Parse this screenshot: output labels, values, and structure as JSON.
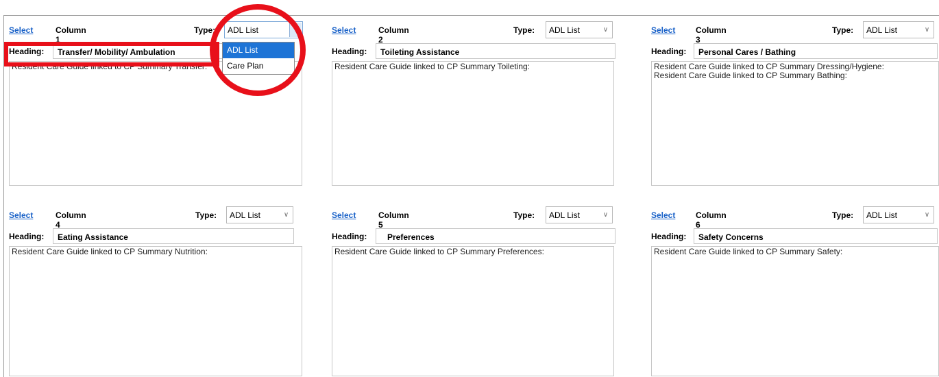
{
  "columns": [
    {
      "select": "Select",
      "name": "Column 1",
      "type_label": "Type:",
      "type_value": "ADL List",
      "heading_label": "Heading:",
      "heading_value": "Transfer/ Mobility/ Ambulation",
      "text": "Resident Care Guide linked to CP Summary Transfer:"
    },
    {
      "select": "Select",
      "name": "Column 2",
      "type_label": "Type:",
      "type_value": "ADL List",
      "heading_label": "Heading:",
      "heading_value": "Toileting Assistance",
      "text": "Resident Care Guide linked to CP Summary Toileting:"
    },
    {
      "select": "Select",
      "name": "Column 3",
      "type_label": "Type:",
      "type_value": "ADL List",
      "heading_label": "Heading:",
      "heading_value": "Personal Cares / Bathing",
      "text": "Resident Care Guide linked to CP Summary Dressing/Hygiene:\nResident Care Guide linked to CP Summary Bathing:"
    },
    {
      "select": "Select",
      "name": "Column 4",
      "type_label": "Type:",
      "type_value": "ADL List",
      "heading_label": "Heading:",
      "heading_value": "Eating Assistance",
      "text": "Resident Care Guide linked to CP Summary Nutrition:"
    },
    {
      "select": "Select",
      "name": "Column 5",
      "type_label": "Type:",
      "type_value": "ADL List",
      "heading_label": "Heading:",
      "heading_value": "Preferences",
      "text": "Resident Care Guide linked to CP Summary Preferences:"
    },
    {
      "select": "Select",
      "name": "Column 6",
      "type_label": "Type:",
      "type_value": "ADL List",
      "heading_label": "Heading:",
      "heading_value": "Safety Concerns",
      "text": "Resident Care Guide linked to CP Summary Safety:"
    }
  ],
  "dropdown_menu": {
    "options": [
      "ADL List",
      "Care Plan"
    ],
    "highlighted": "ADL List"
  },
  "colors": {
    "link": "#1a62c8",
    "highlight": "#1e74d6",
    "annotation": "#e8101a"
  },
  "icons": {
    "dropdown_arrow": "chevron-down-icon"
  }
}
